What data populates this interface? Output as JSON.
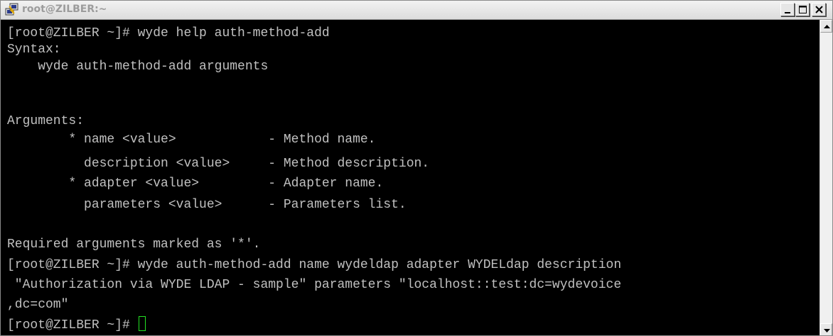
{
  "window": {
    "title": "root@ZILBER:~",
    "controls": {
      "minimize_icon": "minimize-icon",
      "maximize_icon": "maximize-icon",
      "close_icon": "close-icon"
    }
  },
  "terminal": {
    "lines": [
      "[root@ZILBER ~]# wyde help auth-method-add",
      "Syntax:",
      "    wyde auth-method-add arguments",
      "",
      "Arguments:",
      "        * name <value>            - Method name.",
      "          description <value>     - Method description.",
      "        * adapter <value>         - Adapter name.",
      "          parameters <value>      - Parameters list.",
      "",
      "Required arguments marked as '*'.",
      "[root@ZILBER ~]# wyde auth-method-add name wydeldap adapter WYDELdap description",
      " \"Authorization via WYDE LDAP - sample\" parameters \"localhost::test:dc=wydevoice",
      ",dc=com\"",
      "[root@ZILBER ~]# "
    ]
  },
  "colors": {
    "background": "#000000",
    "text": "#c0c0c0",
    "cursor": "#23e323",
    "titlebar": "#e6e6e6"
  }
}
